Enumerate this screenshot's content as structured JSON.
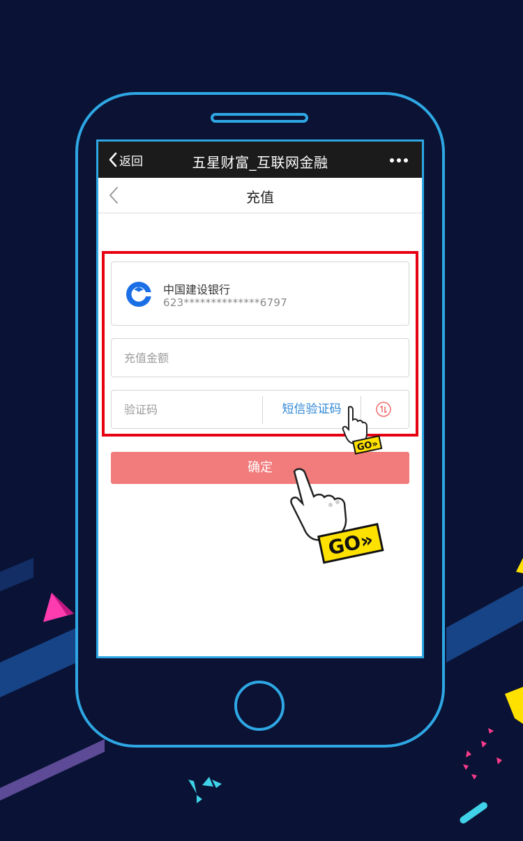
{
  "window": {
    "back_label": "返回",
    "title": "五星财富_互联网金融",
    "more_icon": "more-dots-icon"
  },
  "page": {
    "title": "充值",
    "back_icon": "chevron-left-icon"
  },
  "bank_card": {
    "bank_name": "中国建设银行",
    "card_number": "623**************6797",
    "logo_icon": "ccb-logo-icon"
  },
  "form": {
    "amount_placeholder": "充值金额",
    "amount_value": "",
    "code_placeholder": "验证码",
    "code_value": "",
    "sms_button_label": "短信验证码",
    "switch_icon": "switch-arrows-icon",
    "confirm_label": "确定"
  },
  "overlay": {
    "go_badge_text": "GO»",
    "hand_icon": "pointing-hand-icon"
  },
  "colors": {
    "background": "#0a1335",
    "phone_outline": "#2ea7e4",
    "highlight_box": "#e60012",
    "confirm_button": "#f27b7b",
    "sms_link": "#2b86d6",
    "bank_logo": "#1a6fe6",
    "go_badge": "#ffe100"
  }
}
